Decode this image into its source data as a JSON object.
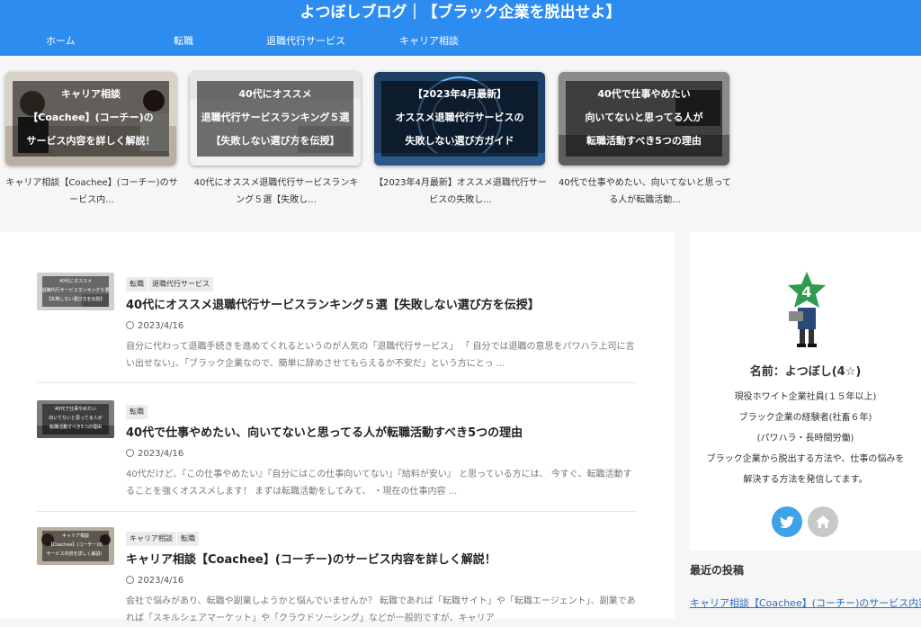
{
  "header": {
    "title": "よつぼしブログ｜【ブラック企業を脱出せよ】",
    "nav": [
      "ホーム",
      "転職",
      "退職代行サービス",
      "キャリア相談"
    ]
  },
  "carousel": [
    {
      "thumb_lines": [
        "キャリア相談",
        "【Coachee】(コーチー)の",
        "サービス内容を詳しく解説！"
      ],
      "caption": "キャリア相談【Coachee】(コーチー)のサービス内..."
    },
    {
      "thumb_lines": [
        "40代にオススメ",
        "退職代行サービスランキング５選",
        "【失敗しない選び方を伝授】"
      ],
      "caption": "40代にオススメ退職代行サービスランキング５選【失敗し..."
    },
    {
      "thumb_lines": [
        "【2023年4月最新】",
        "オススメ退職代行サービスの",
        "失敗しない選び方ガイド"
      ],
      "caption": "【2023年4月最新】オススメ退職代行サービスの失敗し..."
    },
    {
      "thumb_lines": [
        "40代で仕事やめたい",
        "向いてないと思ってる人が",
        "転職活動すべき5つの理由"
      ],
      "caption": "40代で仕事やめたい、向いてないと思ってる人が転職活動..."
    }
  ],
  "posts": [
    {
      "thumb_lines": [
        "40代にオススメ",
        "退職代行サービスランキング５選",
        "【失敗しない選び方を伝授】"
      ],
      "categories": [
        "転職",
        "退職代行サービス"
      ],
      "title": "40代にオススメ退職代行サービスランキング５選【失敗しない選び方を伝授】",
      "date": "2023/4/16",
      "excerpt": "自分に代わって退職手続きを進めてくれるというのが人気の「退職代行サービス」 「 自分では退職の意思をパワハラ上司に言い出せない」、「ブラック企業なので、簡単に辞めさせてもらえるか不安だ」という方にとっ ..."
    },
    {
      "thumb_lines": [
        "40代で仕事やめたい",
        "向いてないと思ってる人が",
        "転職活動すべき5つの理由"
      ],
      "categories": [
        "転職"
      ],
      "title": "40代で仕事やめたい、向いてないと思ってる人が転職活動すべき5つの理由",
      "date": "2023/4/16",
      "excerpt": "40代だけど、『この仕事やめたい』『自分にはこの仕事向いてない』『給料が安い』 と思っている方には、 今すぐ、転職活動することを強くオススメします！ まずは転職活動をしてみて、 ・現在の仕事内容 ..."
    },
    {
      "thumb_lines": [
        "キャリア相談",
        "【Coachee】(コーチー)の",
        "サービス内容を詳しく解説！"
      ],
      "categories": [
        "キャリア相談",
        "転職"
      ],
      "title": "キャリア相談【Coachee】(コーチー)のサービス内容を詳しく解説！",
      "date": "2023/4/16",
      "excerpt": "会社で悩みがあり、転職や副業しようかと悩んでいませんか？ 転職であれば「転職サイト」や「転職エージェント」、副業であれば「スキルシェアマーケット」や「クラウドソーシング」などが一般的ですが、キャリア"
    }
  ],
  "profile": {
    "name": "名前：よつぼし(4☆)",
    "lines": [
      "現役ホワイト企業社員(１５年以上)",
      "ブラック企業の経験者(社畜６年)",
      "(パワハラ・長時間労働)",
      "ブラック企業から脱出する方法や、仕事の悩みを解決する方法を発信してます。"
    ],
    "avatar_number": "4"
  },
  "recent": {
    "title": "最近の投稿",
    "first_link": "キャリア相談【Coachee】(コーチー)のサービス内容を詳しく解説！"
  },
  "colors": {
    "header": "#2d8cf0",
    "twitter": "#3da2e8",
    "home_button": "#c8c8c8"
  }
}
